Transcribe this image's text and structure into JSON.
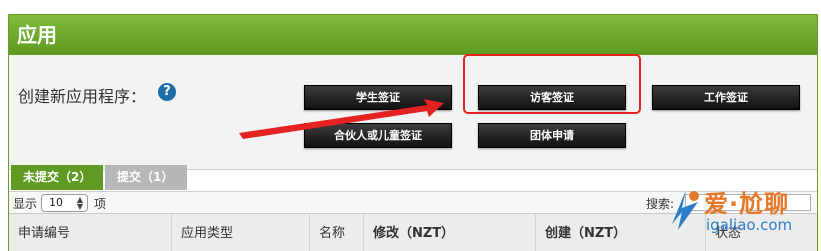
{
  "panel": {
    "title": "应用"
  },
  "create": {
    "label": "创建新应用程序：",
    "help_icon": "question-circle-icon",
    "buttons": [
      {
        "label": "学生签证"
      },
      {
        "label": "访客签证"
      },
      {
        "label": "工作签证"
      },
      {
        "label": "合伙人或儿童签证"
      },
      {
        "label": "团体申请"
      }
    ],
    "highlight_color": "#e52222"
  },
  "tabs": [
    {
      "label": "未提交（2）",
      "active": true
    },
    {
      "label": "提交（1）",
      "active": false
    }
  ],
  "controls": {
    "show_label": "显示",
    "page_length": "10",
    "items_label": "项",
    "search_label": "搜索:"
  },
  "table": {
    "columns": [
      {
        "label": "申请编号"
      },
      {
        "label": "应用类型"
      },
      {
        "label": "名称"
      },
      {
        "label": "修改（NZT）"
      },
      {
        "label": "创建（NZT）"
      },
      {
        "label": "状态"
      }
    ]
  },
  "watermark": {
    "title": "爱·尬聊",
    "subtitle": "igaliao.com"
  },
  "colors": {
    "header_green": "#6aa82b",
    "tab_active": "#5f9a22",
    "tab_inactive": "#b7b7b7",
    "button_black": "#1a1a1a"
  }
}
